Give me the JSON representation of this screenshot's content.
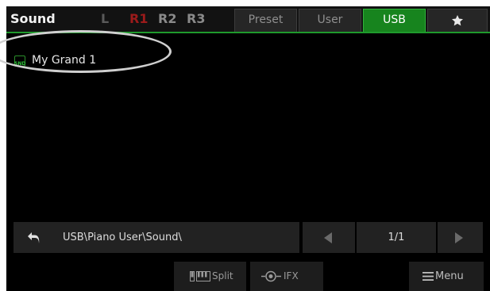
{
  "header": {
    "title": "Sound",
    "parts": [
      {
        "label": "L",
        "color": "#5a5a5a"
      },
      {
        "label": "R1",
        "color": "#9c1b1b"
      },
      {
        "label": "R2",
        "color": "#8a8a8a"
      },
      {
        "label": "R3",
        "color": "#8a8a8a"
      }
    ],
    "tabs": {
      "preset": "Preset",
      "user": "User",
      "usb": "USB",
      "favorite_icon": "star-icon"
    },
    "active_tab": "USB",
    "accent_color": "#17841e"
  },
  "list": {
    "items": [
      {
        "icon": "snd-file-icon",
        "icon_text": "SND",
        "label": "My Grand 1"
      }
    ]
  },
  "footer": {
    "back_icon": "back-arrow-icon",
    "path": "USB\\Piano User\\Sound\\",
    "page": "1/1",
    "prev_icon": "triangle-left-icon",
    "next_icon": "triangle-right-icon"
  },
  "buttons": {
    "split": {
      "icon": "keyboard-split-icon",
      "label": "Split"
    },
    "ifx": {
      "icon": "ifx-knob-icon",
      "label": "IFX"
    },
    "menu": {
      "icon": "hamburger-menu-icon",
      "label": "Menu"
    }
  }
}
